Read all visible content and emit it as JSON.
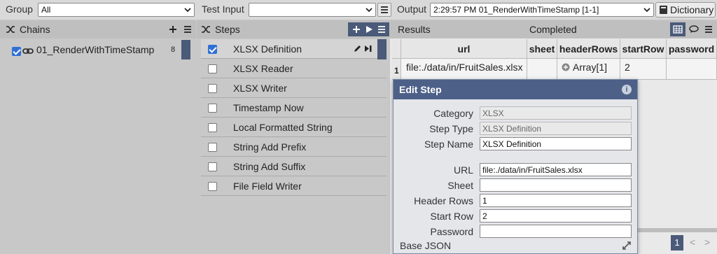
{
  "topbar": {
    "group_label": "Group",
    "group_value": "All",
    "test_input_label": "Test Input",
    "test_input_value": "",
    "output_label": "Output",
    "output_value": "2:29:57 PM 01_RenderWithTimeStamp [1-1]",
    "dictionary_label": "Dictionary"
  },
  "chains": {
    "title": "Chains",
    "items": [
      {
        "label": "01_RenderWithTimeStamp",
        "count": "8",
        "checked": true
      }
    ]
  },
  "steps": {
    "title": "Steps",
    "items": [
      {
        "label": "XLSX Definition",
        "checked": true
      },
      {
        "label": "XLSX Reader",
        "checked": false
      },
      {
        "label": "XLSX Writer",
        "checked": false
      },
      {
        "label": "Timestamp Now",
        "checked": false
      },
      {
        "label": "Local Formatted String",
        "checked": false
      },
      {
        "label": "String Add Prefix",
        "checked": false
      },
      {
        "label": "String Add Suffix",
        "checked": false
      },
      {
        "label": "File Field Writer",
        "checked": false
      }
    ]
  },
  "results": {
    "title": "Results",
    "status": "Completed",
    "columns": [
      "url",
      "sheet",
      "headerRows",
      "startRow",
      "password"
    ],
    "rows": [
      {
        "index": "1",
        "url": "file:./data/in/FruitSales.xlsx",
        "sheet": "",
        "headerRows": "Array[1]",
        "startRow": "2",
        "password": ""
      }
    ],
    "page": "1"
  },
  "edit_step": {
    "title": "Edit Step",
    "fields": {
      "category": {
        "label": "Category",
        "value": "XLSX"
      },
      "step_type": {
        "label": "Step Type",
        "value": "XLSX Definition"
      },
      "step_name": {
        "label": "Step Name",
        "value": "XLSX Definition"
      },
      "url": {
        "label": "URL",
        "value": "file:./data/in/FruitSales.xlsx"
      },
      "sheet": {
        "label": "Sheet",
        "value": ""
      },
      "header_rows": {
        "label": "Header Rows",
        "value": "1"
      },
      "start_row": {
        "label": "Start Row",
        "value": "2"
      },
      "password": {
        "label": "Password",
        "value": ""
      }
    },
    "base_json_label": "Base JSON"
  },
  "colors": {
    "accent": "#4d6088",
    "checkbox": "#2f6fd6",
    "panel_bg": "#c8c8c8"
  }
}
